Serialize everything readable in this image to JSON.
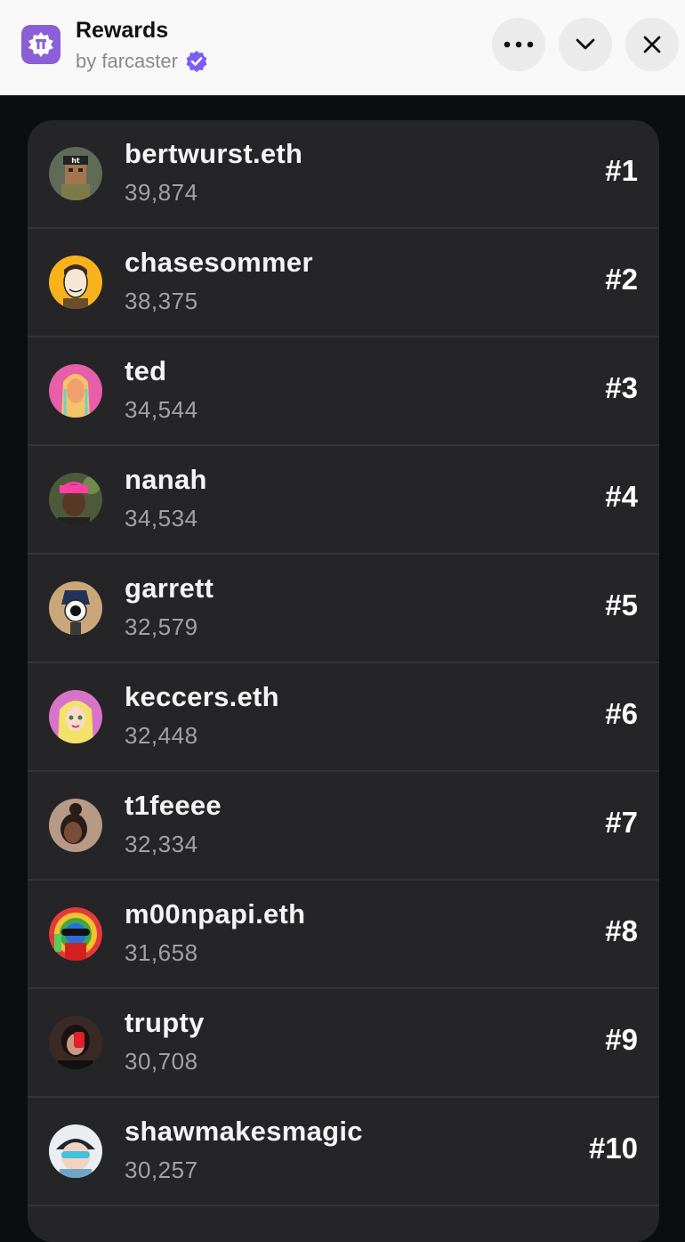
{
  "header": {
    "title": "Rewards",
    "byline": "by farcaster",
    "app_icon": "farcaster-app-icon",
    "verified_icon": "verified-badge-icon",
    "buttons": {
      "more": "more-options-icon",
      "collapse": "chevron-down-icon",
      "close": "close-icon"
    },
    "accent_color": "#8b5fd6",
    "verified_color": "#7c5cf5"
  },
  "leaderboard": [
    {
      "name": "bertwurst.eth",
      "score": "39,874",
      "rank": "#1",
      "avatar_color": "#5f6b56"
    },
    {
      "name": "chasesommer",
      "score": "38,375",
      "rank": "#2",
      "avatar_color": "#f7b21c"
    },
    {
      "name": "ted",
      "score": "34,544",
      "rank": "#3",
      "avatar_color": "#e65fa8"
    },
    {
      "name": "nanah",
      "score": "34,534",
      "rank": "#4",
      "avatar_color": "#4d5a3a"
    },
    {
      "name": "garrett",
      "score": "32,579",
      "rank": "#5",
      "avatar_color": "#c9a77a"
    },
    {
      "name": "keccers.eth",
      "score": "32,448",
      "rank": "#6",
      "avatar_color": "#d774c9"
    },
    {
      "name": "t1feeee",
      "score": "32,334",
      "rank": "#7",
      "avatar_color": "#b79a86"
    },
    {
      "name": "m00npapi.eth",
      "score": "31,658",
      "rank": "#8",
      "avatar_color": "#e23b3b"
    },
    {
      "name": "trupty",
      "score": "30,708",
      "rank": "#9",
      "avatar_color": "#3a2a26"
    },
    {
      "name": "shawmakesmagic",
      "score": "30,257",
      "rank": "#10",
      "avatar_color": "#6fa5c9"
    }
  ]
}
